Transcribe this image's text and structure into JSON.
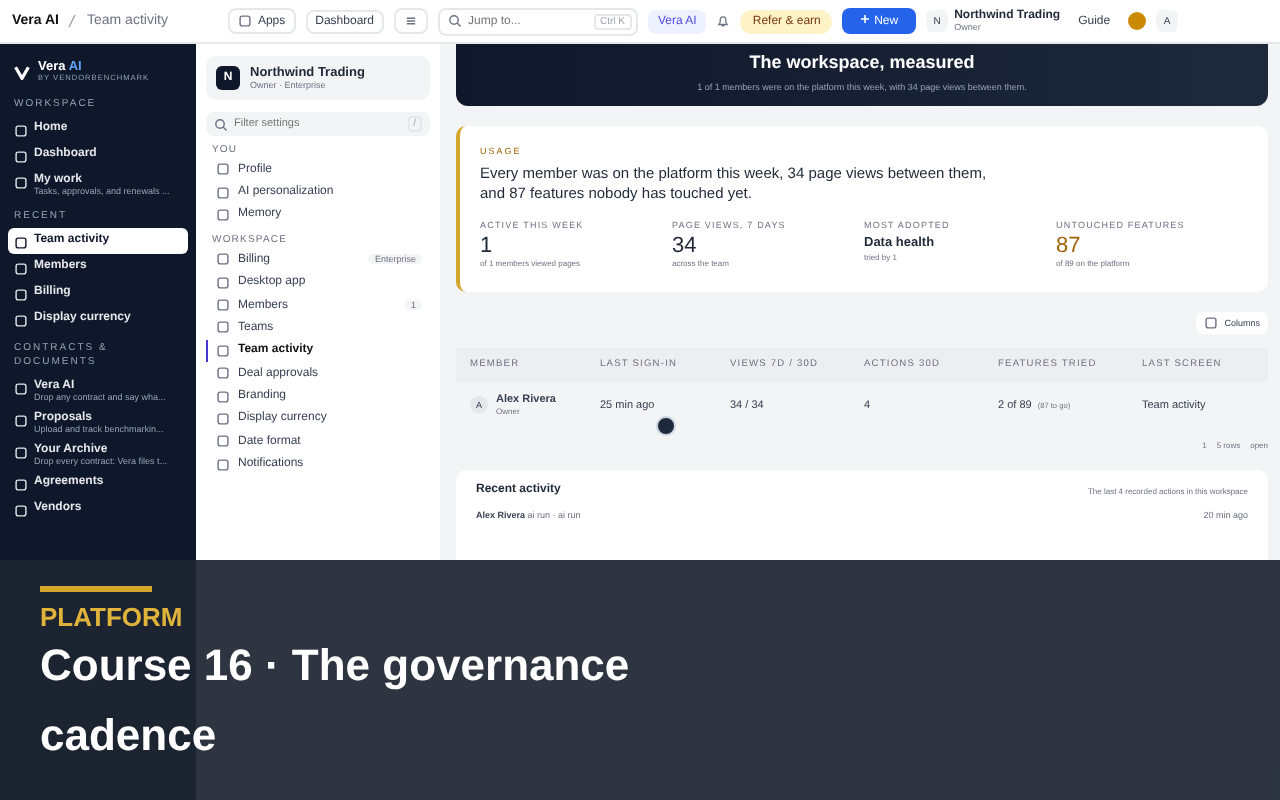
{
  "breadcrumb": [
    "Vera AI",
    "Team activity"
  ],
  "topbar": {
    "apps": "Apps",
    "dashboard": "Dashboard",
    "search_placeholder": "Jump to...",
    "shortcut": "Ctrl K",
    "assistant": "Vera AI",
    "refer": "Refer & earn",
    "new": "New",
    "org": {
      "initial": "N",
      "name": "Northwind Trading",
      "role": "Owner"
    },
    "guide": "Guide",
    "avatar": "A"
  },
  "sidebar": {
    "brand": {
      "name": "Vera",
      "accent": "AI",
      "tagline": "BY VENDORBENCHMARK"
    },
    "sections": [
      {
        "title": "WORKSPACE",
        "items": [
          {
            "label": "Home",
            "selected": false
          },
          {
            "label": "Dashboard",
            "selected": false
          },
          {
            "label": "My work",
            "sub": "Tasks, approvals, and renewals ...",
            "selected": false
          }
        ]
      },
      {
        "title": "RECENT",
        "items": [
          {
            "label": "Team activity",
            "selected": true
          },
          {
            "label": "Members",
            "selected": false
          },
          {
            "label": "Billing",
            "selected": false
          },
          {
            "label": "Display currency",
            "selected": false
          }
        ]
      },
      {
        "title": "CONTRACTS & DOCUMENTS",
        "items": [
          {
            "label": "Vera AI",
            "sub": "Drop any contract and say wha...",
            "selected": false
          },
          {
            "label": "Proposals",
            "sub": "Upload and track benchmarkin...",
            "selected": false
          },
          {
            "label": "Your Archive",
            "sub": "Drop every contract: Vera files t...",
            "selected": false
          },
          {
            "label": "Agreements",
            "selected": false
          },
          {
            "label": "Vendors",
            "selected": false
          }
        ]
      }
    ]
  },
  "settings": {
    "org": {
      "initial": "N",
      "name": "Northwind Trading",
      "sub": "Owner · Enterprise"
    },
    "filter_placeholder": "Filter settings",
    "filter_shortcut": "/",
    "groups": [
      {
        "title": "YOU",
        "items": [
          {
            "label": "Profile",
            "selected": false
          },
          {
            "label": "AI personalization",
            "selected": false
          },
          {
            "label": "Memory",
            "selected": false
          }
        ]
      },
      {
        "title": "WORKSPACE",
        "items": [
          {
            "label": "Billing",
            "badge": "Enterprise",
            "selected": false
          },
          {
            "label": "Desktop app",
            "selected": false
          },
          {
            "label": "Members",
            "badge": "1",
            "selected": false
          },
          {
            "label": "Teams",
            "selected": false
          },
          {
            "label": "Team activity",
            "selected": true
          },
          {
            "label": "Deal approvals",
            "selected": false
          },
          {
            "label": "Branding",
            "selected": false
          },
          {
            "label": "Display currency",
            "selected": false
          },
          {
            "label": "Date format",
            "selected": false
          },
          {
            "label": "Notifications",
            "selected": false
          }
        ]
      }
    ]
  },
  "hero": {
    "title": "The workspace, measured",
    "subtitle": "1 of 1 members were on the platform this week, with 34 page views between them."
  },
  "usage": {
    "eyebrow": "USAGE",
    "headline": "Every member was on the platform this week, 34 page views between them, and 87 features nobody has touched yet.",
    "stats": [
      {
        "label": "ACTIVE THIS WEEK",
        "value": "1",
        "note": "of 1 members viewed pages",
        "kind": "number"
      },
      {
        "label": "PAGE VIEWS, 7 DAYS",
        "value": "34",
        "note": "across the team",
        "kind": "number"
      },
      {
        "label": "MOST ADOPTED",
        "value": "Data health",
        "note": "tried by 1",
        "kind": "name"
      },
      {
        "label": "UNTOUCHED FEATURES",
        "value": "87",
        "note": "of 89 on the platform",
        "kind": "warning"
      }
    ]
  },
  "table": {
    "columns_button": "Columns",
    "columns": [
      "MEMBER",
      "LAST SIGN-IN",
      "VIEWS 7D / 30D",
      "ACTIONS 30D",
      "FEATURES TRIED",
      "LAST SCREEN"
    ],
    "rows": [
      {
        "initial": "A",
        "name": "Alex Rivera",
        "role": "Owner",
        "last_sign_in": "25 min ago",
        "views": "34 / 34",
        "actions": "4",
        "features": "2 of 89",
        "features_note": "(87 to go)",
        "last_screen": "Team activity"
      }
    ],
    "footer": {
      "page": "1",
      "rows": "5 rows",
      "open": "open"
    }
  },
  "recent": {
    "title": "Recent activity",
    "note": "The last 4 recorded actions in this workspace",
    "items": [
      {
        "name": "Alex Rivera",
        "action": "ai run · ai run",
        "time": "20 min ago"
      }
    ]
  },
  "overlay": {
    "eyebrow": "PLATFORM",
    "title": "Course 16 · The governance cadence"
  }
}
